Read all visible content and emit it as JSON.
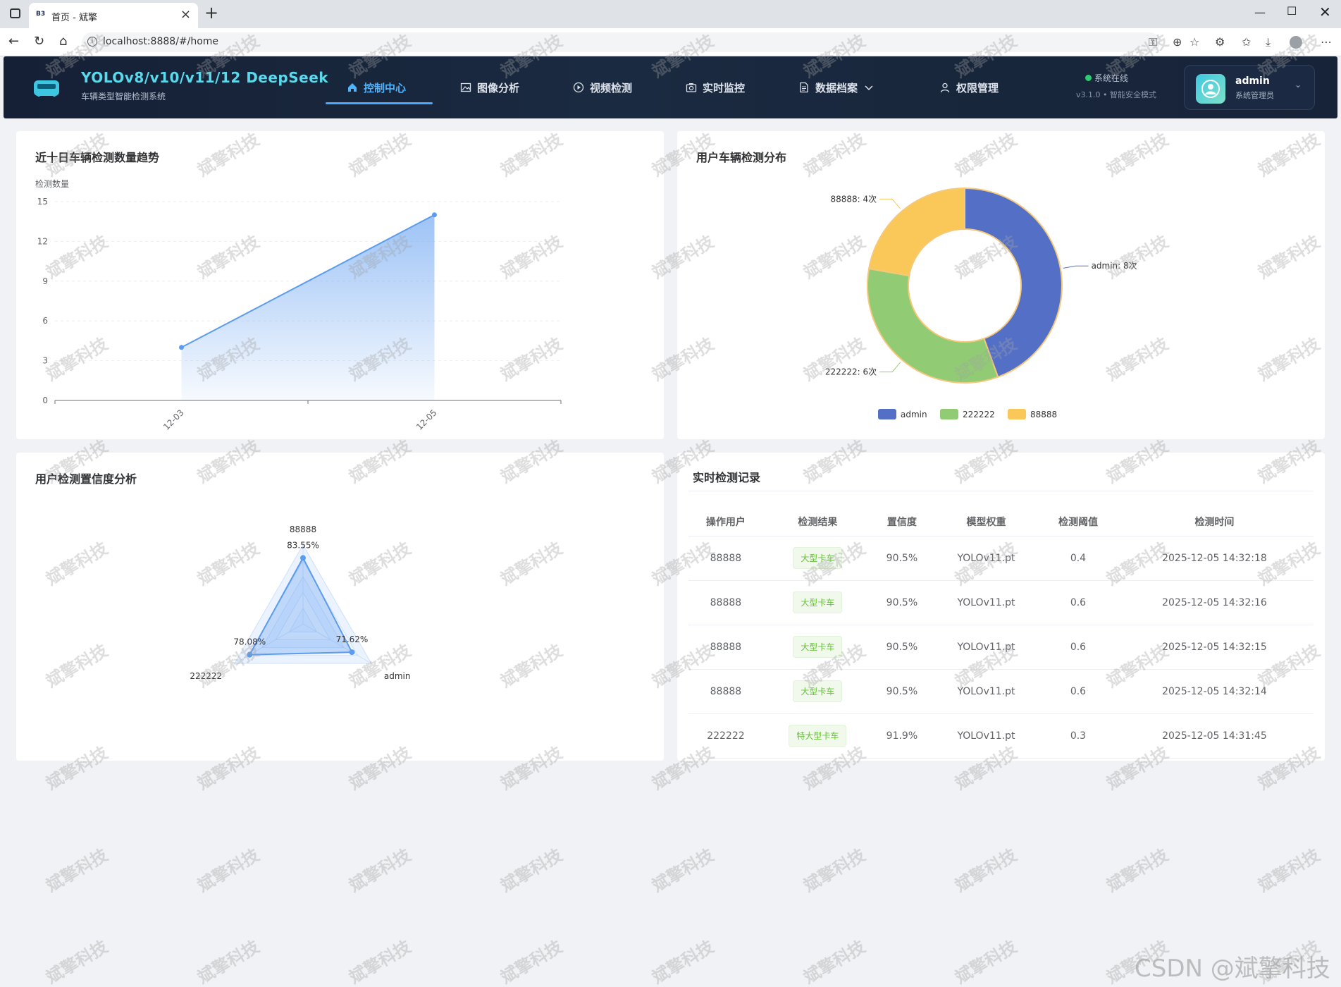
{
  "browser": {
    "tab_title": "首页 - 斌擎",
    "tab_favicon": "B3",
    "url": "localhost:8888/#/home"
  },
  "header": {
    "title": "YOLOv8/v10/v11/12  DeepSeek",
    "subtitle": "车辆类型智能检测系统",
    "nav": [
      {
        "label": "控制中心",
        "icon": "home-icon",
        "active": true
      },
      {
        "label": "图像分析",
        "icon": "image-icon",
        "active": false
      },
      {
        "label": "视频检测",
        "icon": "play-icon",
        "active": false
      },
      {
        "label": "实时监控",
        "icon": "camera-icon",
        "active": false
      },
      {
        "label": "数据档案",
        "icon": "document-icon",
        "active": false
      },
      {
        "label": "权限管理",
        "icon": "user-icon",
        "active": false
      }
    ],
    "status": "系统在线",
    "version": "v3.1.0 • 智能安全模式",
    "user": {
      "name": "admin",
      "role": "系统管理员"
    }
  },
  "panels": {
    "trend_title": "近十日车辆检测数量趋势",
    "pie_title": "用户车辆检测分布",
    "radar_title": "用户检测置信度分析",
    "records_title": "实时检测记录"
  },
  "chart_data": [
    {
      "type": "area",
      "title": "近十日车辆检测数量趋势",
      "ylabel": "检测数量",
      "x": [
        "12-03",
        "12-05"
      ],
      "values": [
        4,
        14
      ],
      "yticks": [
        0,
        3,
        6,
        9,
        12,
        15
      ],
      "ylim": [
        0,
        15
      ],
      "color": "#5b9bf0"
    },
    {
      "type": "pie",
      "title": "用户车辆检测分布",
      "slices": [
        {
          "name": "admin",
          "value": 8,
          "label": "admin: 8次",
          "color": "#5470c6"
        },
        {
          "name": "222222",
          "value": 6,
          "label": "222222: 6次",
          "color": "#91cc75"
        },
        {
          "name": "88888",
          "value": 4,
          "label": "88888: 4次",
          "color": "#fac858"
        }
      ],
      "legend": "bottom"
    },
    {
      "type": "radar",
      "title": "用户检测置信度分析",
      "indicators": [
        "88888",
        "admin",
        "222222"
      ],
      "values": [
        83.55,
        71.62,
        78.08
      ],
      "value_labels": [
        "83.55%",
        "71.62%",
        "78.08%"
      ],
      "max": 100
    }
  ],
  "records": {
    "headers": [
      "操作用户",
      "检测结果",
      "置信度",
      "模型权重",
      "检测阈值",
      "检测时间"
    ],
    "rows": [
      [
        "88888",
        "大型卡车",
        "90.5%",
        "YOLOv11.pt",
        "0.4",
        "2025-12-05 14:32:18"
      ],
      [
        "88888",
        "大型卡车",
        "90.5%",
        "YOLOv11.pt",
        "0.6",
        "2025-12-05 14:32:16"
      ],
      [
        "88888",
        "大型卡车",
        "90.5%",
        "YOLOv11.pt",
        "0.6",
        "2025-12-05 14:32:15"
      ],
      [
        "88888",
        "大型卡车",
        "90.5%",
        "YOLOv11.pt",
        "0.6",
        "2025-12-05 14:32:14"
      ],
      [
        "222222",
        "特大型卡车",
        "91.9%",
        "YOLOv11.pt",
        "0.3",
        "2025-12-05 14:31:45"
      ]
    ]
  },
  "watermark": "斌擎科技",
  "footer_watermark": "CSDN @斌擎科技"
}
